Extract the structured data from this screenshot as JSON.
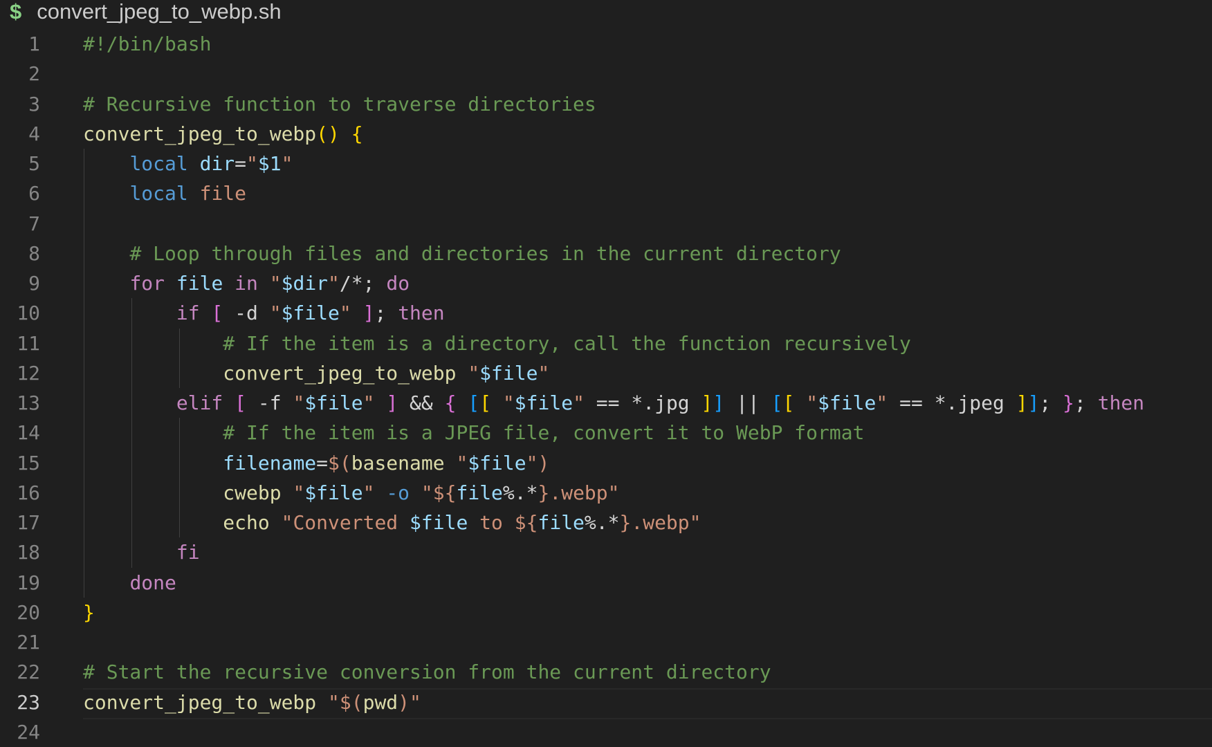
{
  "tab": {
    "icon": "$",
    "filename": "convert_jpeg_to_webp.sh"
  },
  "editor": {
    "current_line": 23,
    "lines": [
      {
        "n": "1",
        "tokens": [
          {
            "t": "#!/bin/bash",
            "c": "comment"
          }
        ]
      },
      {
        "n": "2",
        "tokens": []
      },
      {
        "n": "3",
        "tokens": [
          {
            "t": "# Recursive function to traverse directories",
            "c": "comment"
          }
        ]
      },
      {
        "n": "4",
        "tokens": [
          {
            "t": "convert_jpeg_to_webp",
            "c": "func"
          },
          {
            "t": "()",
            "c": "brace-y"
          },
          {
            "t": " ",
            "c": "plain"
          },
          {
            "t": "{",
            "c": "brace-y"
          }
        ]
      },
      {
        "n": "5",
        "tokens": [
          {
            "t": "    ",
            "c": "plain"
          },
          {
            "t": "local",
            "c": "kw-blue"
          },
          {
            "t": " ",
            "c": "plain"
          },
          {
            "t": "dir",
            "c": "var"
          },
          {
            "t": "=",
            "c": "plain"
          },
          {
            "t": "\"",
            "c": "str"
          },
          {
            "t": "$1",
            "c": "var"
          },
          {
            "t": "\"",
            "c": "str"
          }
        ]
      },
      {
        "n": "6",
        "tokens": [
          {
            "t": "    ",
            "c": "plain"
          },
          {
            "t": "local",
            "c": "kw-blue"
          },
          {
            "t": " ",
            "c": "plain"
          },
          {
            "t": "file",
            "c": "str"
          }
        ]
      },
      {
        "n": "7",
        "tokens": []
      },
      {
        "n": "8",
        "tokens": [
          {
            "t": "    ",
            "c": "plain"
          },
          {
            "t": "# Loop through files and directories in the current directory",
            "c": "comment"
          }
        ]
      },
      {
        "n": "9",
        "tokens": [
          {
            "t": "    ",
            "c": "plain"
          },
          {
            "t": "for",
            "c": "kw-ctrl"
          },
          {
            "t": " ",
            "c": "plain"
          },
          {
            "t": "file",
            "c": "var"
          },
          {
            "t": " ",
            "c": "plain"
          },
          {
            "t": "in",
            "c": "kw-ctrl"
          },
          {
            "t": " ",
            "c": "plain"
          },
          {
            "t": "\"",
            "c": "str"
          },
          {
            "t": "$dir",
            "c": "var"
          },
          {
            "t": "\"",
            "c": "str"
          },
          {
            "t": "/*; ",
            "c": "plain"
          },
          {
            "t": "do",
            "c": "kw-ctrl"
          }
        ]
      },
      {
        "n": "10",
        "tokens": [
          {
            "t": "        ",
            "c": "plain"
          },
          {
            "t": "if",
            "c": "kw-ctrl"
          },
          {
            "t": " ",
            "c": "plain"
          },
          {
            "t": "[",
            "c": "brace-p"
          },
          {
            "t": " -d ",
            "c": "plain"
          },
          {
            "t": "\"",
            "c": "str"
          },
          {
            "t": "$file",
            "c": "var"
          },
          {
            "t": "\"",
            "c": "str"
          },
          {
            "t": " ",
            "c": "plain"
          },
          {
            "t": "]",
            "c": "brace-p"
          },
          {
            "t": "; ",
            "c": "plain"
          },
          {
            "t": "then",
            "c": "kw-ctrl"
          }
        ]
      },
      {
        "n": "11",
        "tokens": [
          {
            "t": "            ",
            "c": "plain"
          },
          {
            "t": "# If the item is a directory, call the function recursively",
            "c": "comment"
          }
        ]
      },
      {
        "n": "12",
        "tokens": [
          {
            "t": "            ",
            "c": "plain"
          },
          {
            "t": "convert_jpeg_to_webp",
            "c": "func"
          },
          {
            "t": " ",
            "c": "plain"
          },
          {
            "t": "\"",
            "c": "str"
          },
          {
            "t": "$file",
            "c": "var"
          },
          {
            "t": "\"",
            "c": "str"
          }
        ]
      },
      {
        "n": "13",
        "tokens": [
          {
            "t": "        ",
            "c": "plain"
          },
          {
            "t": "elif",
            "c": "kw-ctrl"
          },
          {
            "t": " ",
            "c": "plain"
          },
          {
            "t": "[",
            "c": "brace-p"
          },
          {
            "t": " -f ",
            "c": "plain"
          },
          {
            "t": "\"",
            "c": "str"
          },
          {
            "t": "$file",
            "c": "var"
          },
          {
            "t": "\"",
            "c": "str"
          },
          {
            "t": " ",
            "c": "plain"
          },
          {
            "t": "]",
            "c": "brace-p"
          },
          {
            "t": " && ",
            "c": "plain"
          },
          {
            "t": "{",
            "c": "brace-p"
          },
          {
            "t": " ",
            "c": "plain"
          },
          {
            "t": "[",
            "c": "brace-b"
          },
          {
            "t": "[",
            "c": "brace-y"
          },
          {
            "t": " ",
            "c": "plain"
          },
          {
            "t": "\"",
            "c": "str"
          },
          {
            "t": "$file",
            "c": "var"
          },
          {
            "t": "\"",
            "c": "str"
          },
          {
            "t": " == *.jpg ",
            "c": "plain"
          },
          {
            "t": "]",
            "c": "brace-y"
          },
          {
            "t": "]",
            "c": "brace-b"
          },
          {
            "t": " || ",
            "c": "plain"
          },
          {
            "t": "[",
            "c": "brace-b"
          },
          {
            "t": "[",
            "c": "brace-y"
          },
          {
            "t": " ",
            "c": "plain"
          },
          {
            "t": "\"",
            "c": "str"
          },
          {
            "t": "$file",
            "c": "var"
          },
          {
            "t": "\"",
            "c": "str"
          },
          {
            "t": " == *.jpeg ",
            "c": "plain"
          },
          {
            "t": "]",
            "c": "brace-y"
          },
          {
            "t": "]",
            "c": "brace-b"
          },
          {
            "t": "; ",
            "c": "plain"
          },
          {
            "t": "}",
            "c": "brace-p"
          },
          {
            "t": "; ",
            "c": "plain"
          },
          {
            "t": "then",
            "c": "kw-ctrl"
          }
        ]
      },
      {
        "n": "14",
        "tokens": [
          {
            "t": "            ",
            "c": "plain"
          },
          {
            "t": "# If the item is a JPEG file, convert it to WebP format",
            "c": "comment"
          }
        ]
      },
      {
        "n": "15",
        "tokens": [
          {
            "t": "            ",
            "c": "plain"
          },
          {
            "t": "filename",
            "c": "var"
          },
          {
            "t": "=",
            "c": "plain"
          },
          {
            "t": "$(",
            "c": "str"
          },
          {
            "t": "basename",
            "c": "func"
          },
          {
            "t": " ",
            "c": "plain"
          },
          {
            "t": "\"",
            "c": "str"
          },
          {
            "t": "$file",
            "c": "var"
          },
          {
            "t": "\"",
            "c": "str"
          },
          {
            "t": ")",
            "c": "str"
          }
        ]
      },
      {
        "n": "16",
        "tokens": [
          {
            "t": "            ",
            "c": "plain"
          },
          {
            "t": "cwebp",
            "c": "func"
          },
          {
            "t": " ",
            "c": "plain"
          },
          {
            "t": "\"",
            "c": "str"
          },
          {
            "t": "$file",
            "c": "var"
          },
          {
            "t": "\"",
            "c": "str"
          },
          {
            "t": " ",
            "c": "plain"
          },
          {
            "t": "-o",
            "c": "kw-blue"
          },
          {
            "t": " ",
            "c": "plain"
          },
          {
            "t": "\"${",
            "c": "str"
          },
          {
            "t": "file",
            "c": "var"
          },
          {
            "t": "%.*",
            "c": "plain"
          },
          {
            "t": "}",
            "c": "str"
          },
          {
            "t": ".webp\"",
            "c": "str"
          }
        ]
      },
      {
        "n": "17",
        "tokens": [
          {
            "t": "            ",
            "c": "plain"
          },
          {
            "t": "echo",
            "c": "func"
          },
          {
            "t": " ",
            "c": "plain"
          },
          {
            "t": "\"Converted ",
            "c": "str"
          },
          {
            "t": "$file",
            "c": "var"
          },
          {
            "t": " to ",
            "c": "str"
          },
          {
            "t": "${",
            "c": "str"
          },
          {
            "t": "file",
            "c": "var"
          },
          {
            "t": "%.*",
            "c": "plain"
          },
          {
            "t": "}",
            "c": "str"
          },
          {
            "t": ".webp\"",
            "c": "str"
          }
        ]
      },
      {
        "n": "18",
        "tokens": [
          {
            "t": "        ",
            "c": "plain"
          },
          {
            "t": "fi",
            "c": "kw-ctrl"
          }
        ]
      },
      {
        "n": "19",
        "tokens": [
          {
            "t": "    ",
            "c": "plain"
          },
          {
            "t": "done",
            "c": "kw-ctrl"
          }
        ]
      },
      {
        "n": "20",
        "tokens": [
          {
            "t": "}",
            "c": "brace-y"
          }
        ]
      },
      {
        "n": "21",
        "tokens": []
      },
      {
        "n": "22",
        "tokens": [
          {
            "t": "# Start the recursive conversion from the current directory",
            "c": "comment"
          }
        ]
      },
      {
        "n": "23",
        "tokens": [
          {
            "t": "convert_jpeg_to_webp",
            "c": "func"
          },
          {
            "t": " ",
            "c": "plain"
          },
          {
            "t": "\"",
            "c": "str"
          },
          {
            "t": "$(",
            "c": "str"
          },
          {
            "t": "pwd",
            "c": "func"
          },
          {
            "t": ")",
            "c": "str"
          },
          {
            "t": "\"",
            "c": "str"
          }
        ]
      },
      {
        "n": "24",
        "tokens": []
      }
    ]
  }
}
